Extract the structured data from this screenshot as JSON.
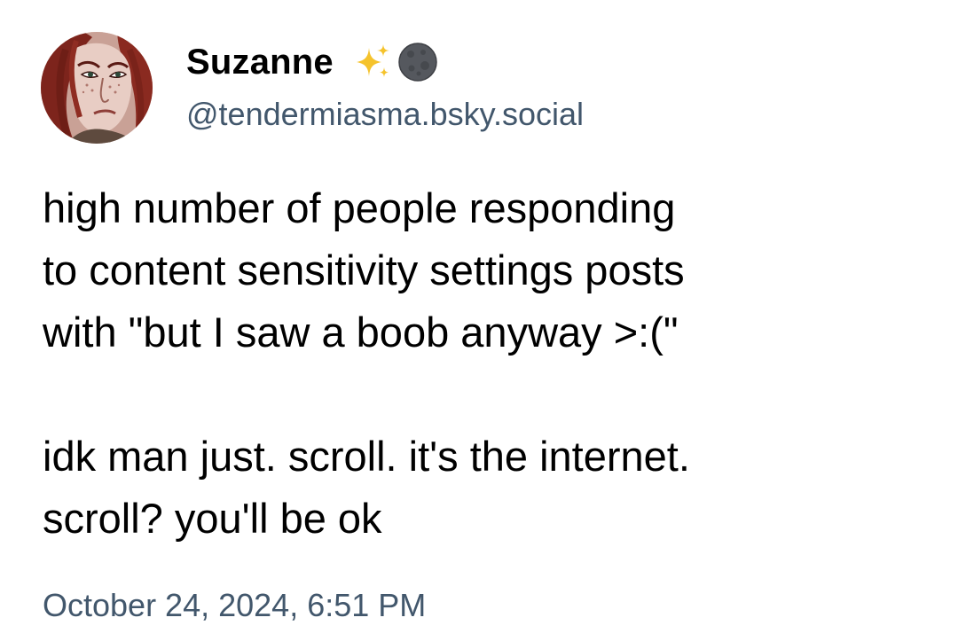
{
  "post": {
    "author": {
      "display_name": "Suzanne",
      "handle": "@tendermiasma.bsky.social",
      "name_icons": [
        "sparkles-icon",
        "new-moon-icon"
      ]
    },
    "text": {
      "paragraph_1": "high number of people responding\nto content sensitivity settings posts\nwith \"but I saw a boob anyway >:(\"",
      "paragraph_2": "idk man just. scroll. it's the internet.\nscroll? you'll be ok"
    },
    "timestamp": "October 24, 2024, 6:51 PM"
  },
  "colors": {
    "text_primary": "#000000",
    "text_secondary": "#42576c",
    "sparkle": "#f5c32c",
    "moon": "#55585e",
    "background": "#ffffff"
  }
}
